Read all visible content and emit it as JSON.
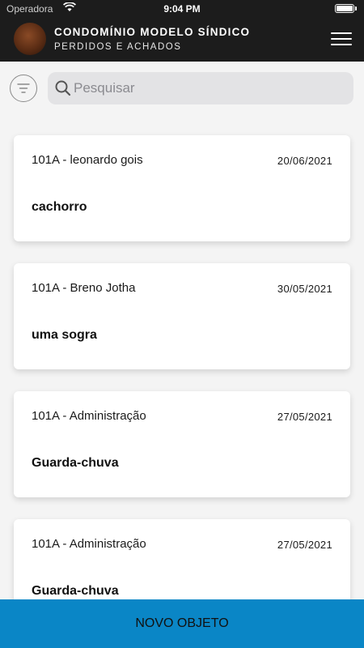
{
  "status_bar": {
    "carrier": "Operadora",
    "time": "9:04 PM"
  },
  "header": {
    "title": "CONDOMÍNIO MODELO SÍNDICO",
    "subtitle": "PERDIDOS E ACHADOS"
  },
  "search": {
    "placeholder": "Pesquisar",
    "value": ""
  },
  "items": [
    {
      "unit": "101A - leonardo gois",
      "date": "20/06/2021",
      "object": "cachorro"
    },
    {
      "unit": "101A - Breno Jotha",
      "date": "30/05/2021",
      "object": "uma sogra"
    },
    {
      "unit": "101A - Administração",
      "date": "27/05/2021",
      "object": "Guarda-chuva"
    },
    {
      "unit": "101A - Administração",
      "date": "27/05/2021",
      "object": "Guarda-chuva"
    }
  ],
  "footer": {
    "new_button_label": "NOVO OBJETO"
  },
  "colors": {
    "header_bg": "#1c1c1c",
    "page_bg": "#f4f4f4",
    "accent_button": "#0a86c6",
    "search_bg": "#e3e3e5"
  },
  "icons": {
    "wifi": "wifi-icon",
    "battery": "battery-icon",
    "menu": "hamburger-menu-icon",
    "filter": "filter-icon",
    "search": "search-icon"
  }
}
